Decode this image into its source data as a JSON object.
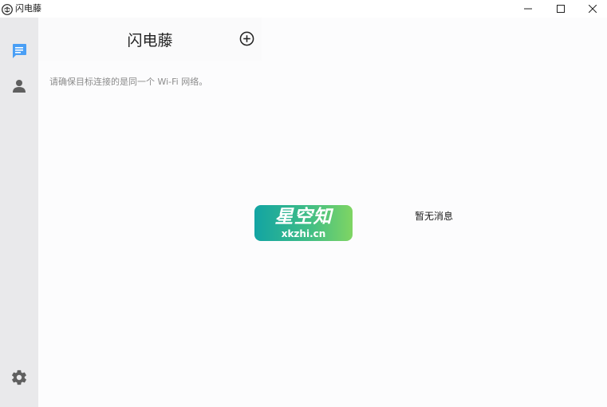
{
  "window": {
    "title": "闪电藤",
    "icons": {
      "app": "lightning-vine-logo",
      "minimize": "minimize-icon",
      "maximize": "maximize-icon",
      "close": "close-icon"
    }
  },
  "sidebar": {
    "items": [
      {
        "name": "chat",
        "icon": "chat-bubble-icon",
        "active": true,
        "color": "#4a9ff5"
      },
      {
        "name": "contacts",
        "icon": "person-icon",
        "active": false,
        "color": "#6a6a6a"
      },
      {
        "name": "settings",
        "icon": "gear-icon",
        "active": false,
        "color": "#6a6a6a"
      }
    ]
  },
  "main": {
    "title": "闪电藤",
    "add_icon": "plus-circle-icon",
    "hint": "请确保目标连接的是同一个 Wi-Fi 网络。",
    "empty_text": "暂无消息"
  },
  "watermark": {
    "title": "星空知",
    "subtitle": "xkzhi.cn"
  }
}
